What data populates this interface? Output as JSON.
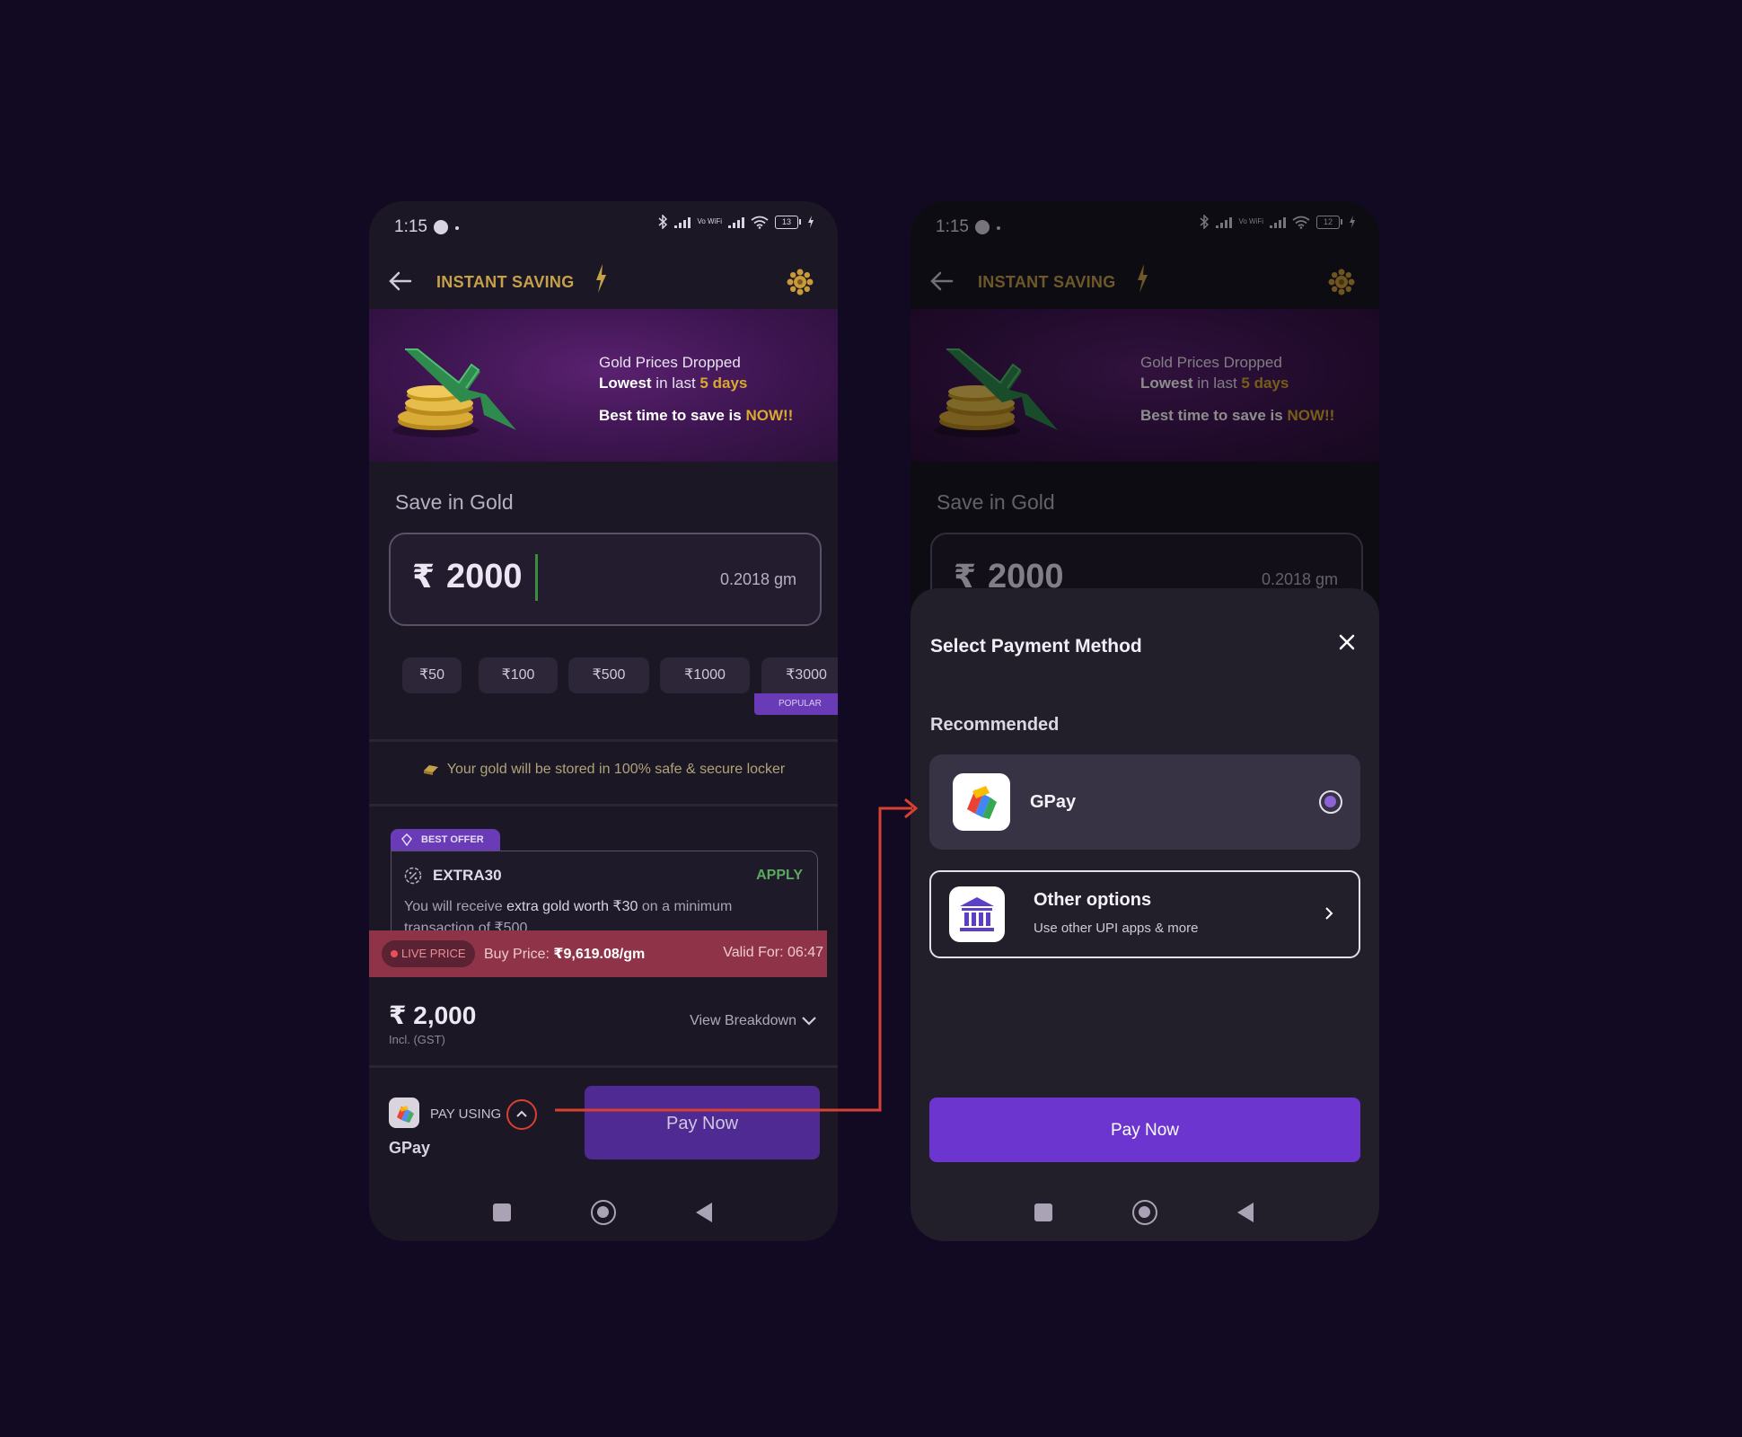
{
  "colors": {
    "background": "#120a22",
    "phone_bg": "#1b1724",
    "gold_accent": "#c6a14a",
    "purple_button": "#6d35cf",
    "live_price_bar": "#8f3448",
    "apply_green": "#5aa95d",
    "connector_red": "#d94030"
  },
  "left": {
    "status": {
      "time": "1:15",
      "wifi_label": "Vo WiFi",
      "battery": "13"
    },
    "header": {
      "title": "INSTANT SAVING",
      "back_icon": "arrow-left-icon",
      "bolt_icon": "lightning-bolt-icon",
      "settings_icon": "gold-gear-icon"
    },
    "banner": {
      "line1": "Gold Prices Dropped",
      "line2_bold": "Lowest",
      "line2_mid": " in last ",
      "line2_hl": "5 days",
      "line3_pre": "Best time to save is ",
      "line3_hl": "NOW!!"
    },
    "save_label": "Save in Gold",
    "amount": {
      "currency": "₹",
      "value": "2000",
      "grams": "0.2018 gm"
    },
    "chips": [
      "₹50",
      "₹100",
      "₹500",
      "₹1000",
      "₹3000"
    ],
    "popular_badge": "POPULAR",
    "locker_note": "Your gold will be stored in 100% safe & secure locker",
    "offer": {
      "badge": "BEST OFFER",
      "code": "EXTRA30",
      "apply": "APPLY",
      "desc_pre": "You will receive ",
      "desc_bold": "extra gold worth ₹30",
      "desc_post": " on a minimum transaction of ₹500"
    },
    "live_price": {
      "pill": "LIVE PRICE",
      "buy_label": "Buy Price: ",
      "buy_value": "₹9,619.08/gm",
      "valid": "Valid For: 06:47"
    },
    "total": {
      "amount": "₹ 2,000",
      "note": "Incl. (GST)",
      "breakdown": "View Breakdown"
    },
    "pay_using": {
      "label": "PAY USING",
      "method": "GPay"
    },
    "pay_now": "Pay Now"
  },
  "right": {
    "status": {
      "time": "1:15",
      "wifi_label": "Vo WiFi",
      "battery": "12"
    },
    "header": {
      "title": "INSTANT SAVING"
    },
    "banner": {
      "line1": "Gold Prices Dropped",
      "line2_bold": "Lowest",
      "line2_mid": " in last ",
      "line2_hl": "5 days",
      "line3_pre": "Best time to save is ",
      "line3_hl": "NOW!!"
    },
    "save_label": "Save in Gold",
    "amount": {
      "currency": "₹",
      "value": "2000",
      "grams": "0.2018 gm"
    },
    "sheet": {
      "title": "Select Payment Method",
      "recommended": "Recommended",
      "gpay_label": "GPay",
      "other_title": "Other options",
      "other_sub": "Use other UPI apps & more",
      "pay_now": "Pay Now"
    }
  }
}
